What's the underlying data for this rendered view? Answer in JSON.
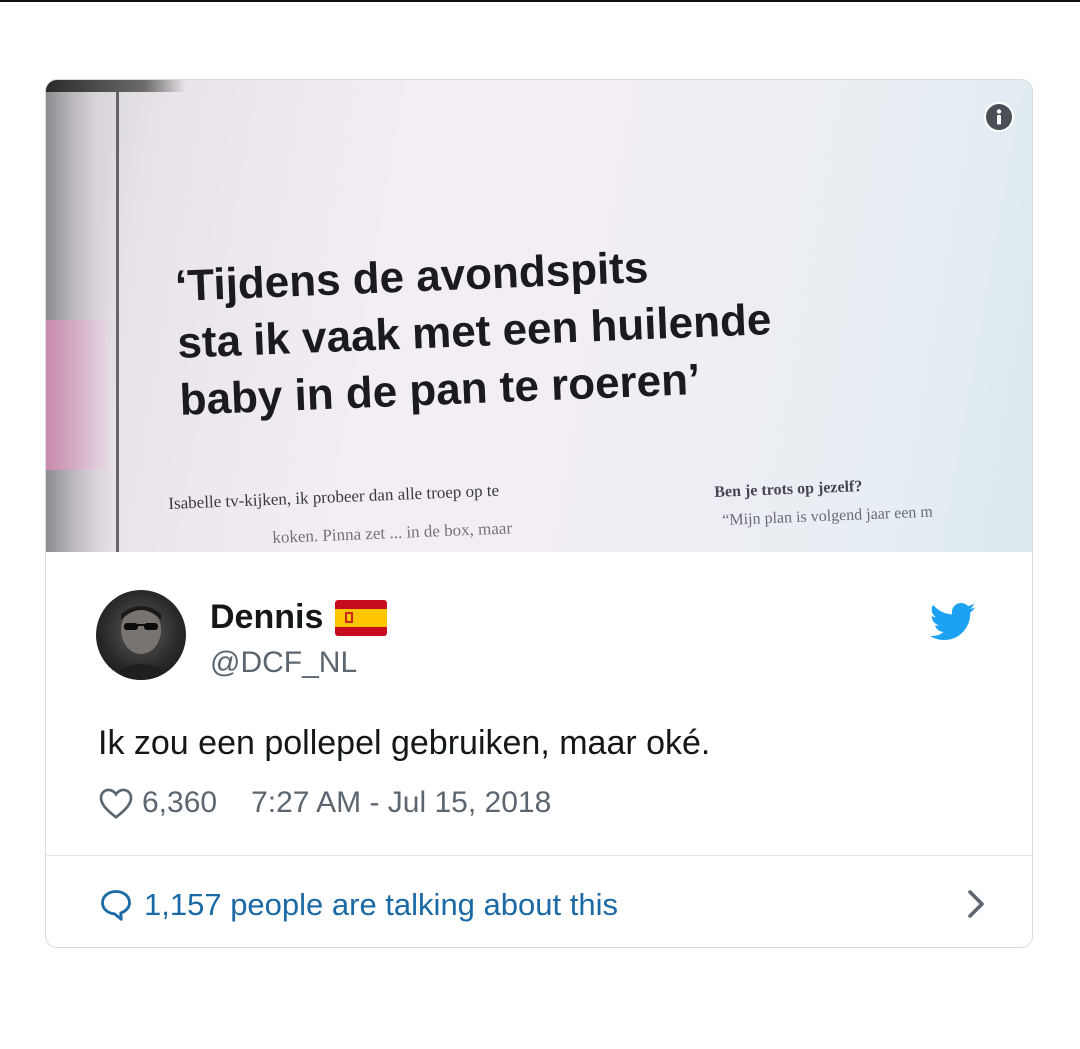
{
  "media": {
    "headline_lines": [
      "‘Tijdens de avondspits",
      "sta ik vaak met een huilende",
      "baby in de pan te roeren’"
    ],
    "body_left_line1": "Isabelle tv-kijken, ik probeer dan alle troep op te",
    "body_left_line2": "koken. Pinna zet ... in de box, maar",
    "body_right_heading": "Ben je trots op jezelf?",
    "body_right_text": "“Mijn plan is volgend jaar een m",
    "info_icon": "info-icon"
  },
  "tweet": {
    "author_name": "Dennis",
    "author_flag": "spain-flag",
    "handle": "@DCF_NL",
    "text": "Ik zou een pollepel gebruiken, maar oké.",
    "likes": "6,360",
    "timestamp": "7:27 AM - Jul 15, 2018",
    "talking": "1,157 people are talking about this",
    "icons": {
      "like": "heart-icon",
      "reply": "speech-bubble-icon",
      "brand": "twitter-bird-icon",
      "more": "chevron-right-icon"
    }
  },
  "colors": {
    "link": "#1b6aa5",
    "twitter_blue": "#1da1f2",
    "muted_text": "#5b6670",
    "border": "#d8dde2"
  }
}
